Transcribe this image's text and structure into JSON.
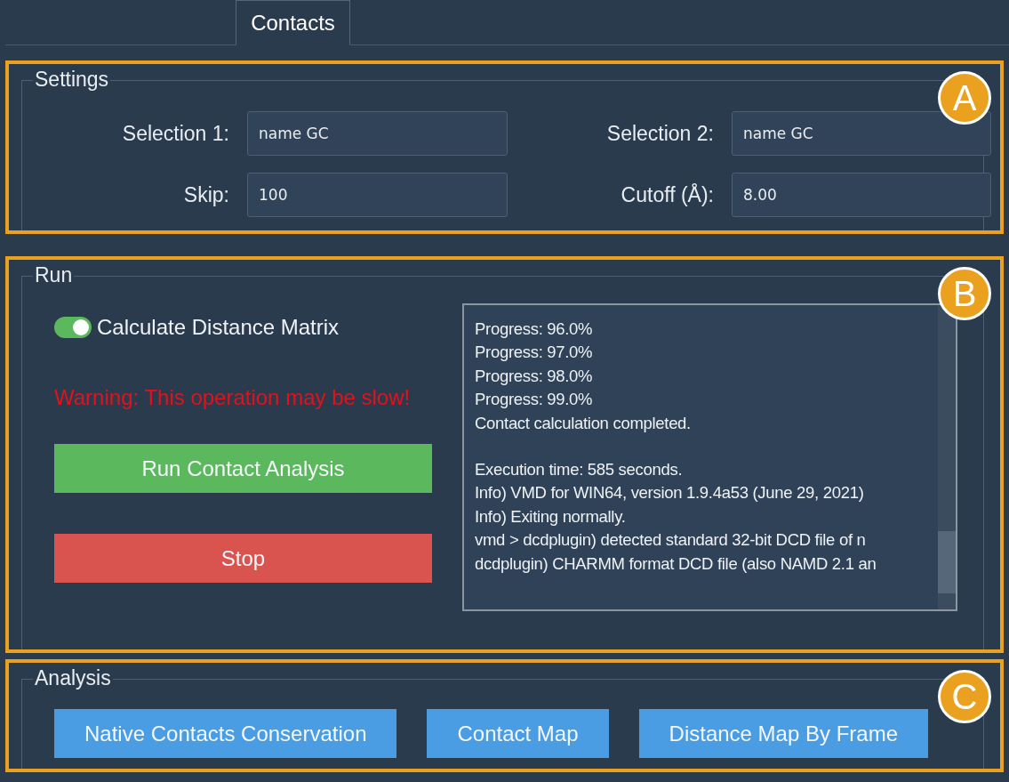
{
  "tabs": [
    {
      "label": "Contacts",
      "selected": true
    }
  ],
  "sections": [
    {
      "callout": "A",
      "kind": "settings",
      "title": "Settings",
      "fields": [
        {
          "label": "Selection 1:",
          "value": "name GC"
        },
        {
          "label": "Selection 2:",
          "value": "name GC"
        },
        {
          "label": "Skip:",
          "value": "100"
        },
        {
          "label": "Cutoff (Å):",
          "value": "8.00"
        }
      ]
    },
    {
      "callout": "B",
      "kind": "run",
      "title": "Run",
      "toggle": {
        "label": "Calculate Distance Matrix",
        "on": true
      },
      "warning": "Warning: This operation may be slow!",
      "buttons": [
        {
          "label": "Run Contact Analysis",
          "kind": "run"
        },
        {
          "label": "Stop",
          "kind": "stop"
        }
      ],
      "log": {
        "blocks": [
          [
            "Progress: 96.0%",
            "Progress: 97.0%",
            "Progress: 98.0%",
            "Progress: 99.0%",
            "Contact calculation completed."
          ],
          [
            "Execution time: 585 seconds.",
            "Info) VMD for WIN64, version 1.9.4a53 (June 29, 2021)",
            "Info) Exiting normally.",
            "vmd > dcdplugin) detected standard 32-bit DCD file of n",
            "dcdplugin) CHARMM format DCD file (also NAMD 2.1 an"
          ]
        ]
      }
    },
    {
      "callout": "C",
      "kind": "analysis",
      "title": "Analysis",
      "buttons": [
        {
          "label": "Native Contacts Conservation"
        },
        {
          "label": "Contact Map"
        },
        {
          "label": "Distance Map By Frame"
        }
      ]
    }
  ]
}
